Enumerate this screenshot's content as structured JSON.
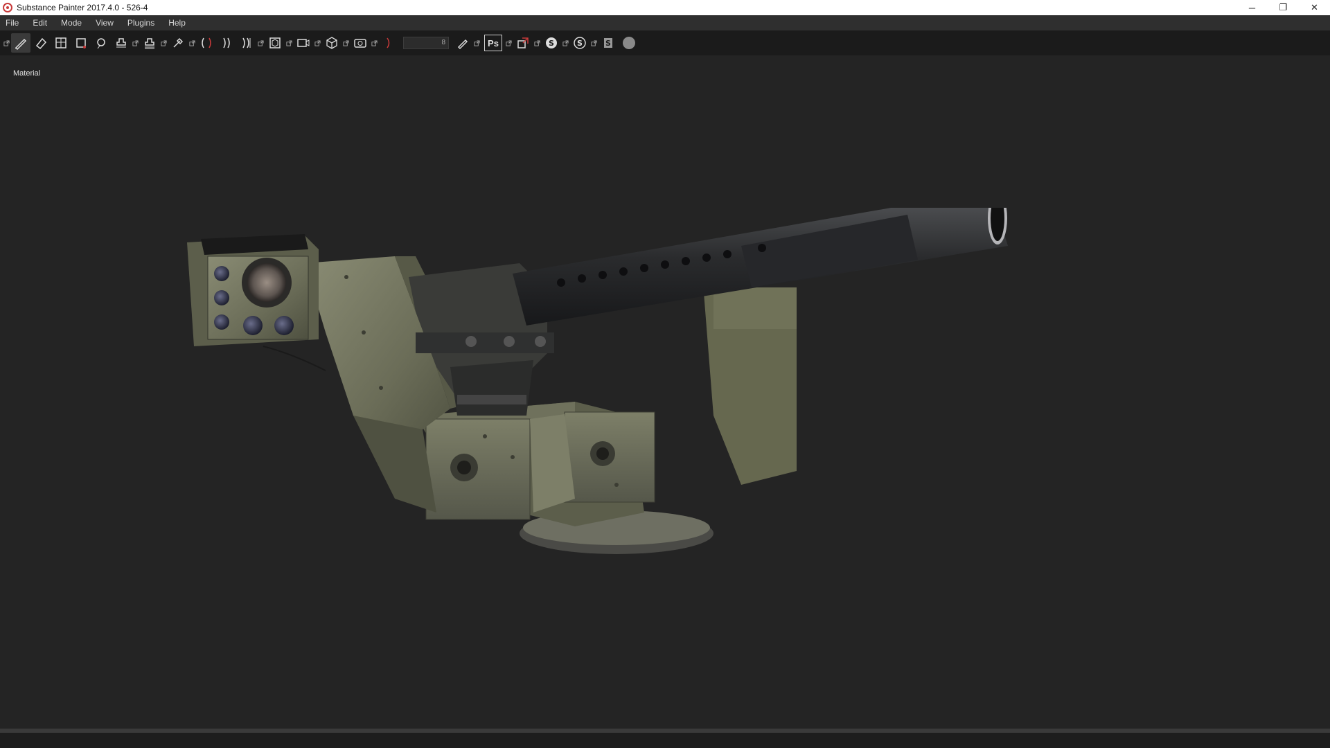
{
  "window": {
    "title": "Substance Painter 2017.4.0 - 526-4",
    "controls": {
      "minimize": "─",
      "restore": "❐",
      "close": "✕"
    }
  },
  "menu": {
    "items": [
      "File",
      "Edit",
      "Mode",
      "View",
      "Plugins",
      "Help"
    ]
  },
  "toolbar": {
    "tools": [
      "paint-brush-icon",
      "eraser-icon",
      "projection-icon",
      "polygon-fill-icon",
      "smudge-icon",
      "clone-icon",
      "bake-icon",
      "color-picker-icon",
      "symmetry-icon",
      "viewport-camera-icon",
      "screenshot-icon"
    ],
    "slider_value": "8",
    "photoshop_label": "Ps",
    "accent_color": "#c83a3a"
  },
  "viewport": {
    "label": "Material",
    "background": "#242424"
  }
}
